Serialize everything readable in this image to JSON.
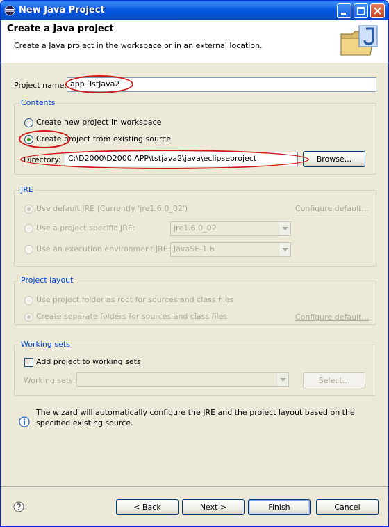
{
  "window": {
    "title": "New Java Project"
  },
  "banner": {
    "title": "Create a Java project",
    "description": "Create a Java project in the workspace or in an external location."
  },
  "project": {
    "label": "Project name:",
    "value": "app_TstJava2"
  },
  "contents": {
    "title": "Contents",
    "option_new": "Create new project in workspace",
    "option_existing": "Create project from existing source",
    "directory_label": "Directory:",
    "directory_value": "C:\\D2000\\D2000.APP\\tstjava2\\java\\eclipseproject",
    "browse_label": "Browse..."
  },
  "jre": {
    "title": "JRE",
    "option_default": "Use default JRE (Currently 'jre1.6.0_02')",
    "configure_label": "Configure default...",
    "option_specific": "Use a project specific JRE:",
    "specific_value": "jre1.6.0_02",
    "option_env": "Use an execution environment JRE:",
    "env_value": "JavaSE-1.6"
  },
  "layout": {
    "title": "Project layout",
    "option_root": "Use project folder as root for sources and class files",
    "option_separate": "Create separate folders for sources and class files",
    "configure_label": "Configure default..."
  },
  "working_sets": {
    "title": "Working sets",
    "add_label": "Add project to working sets",
    "sets_label": "Working sets:",
    "sets_value": "",
    "select_label": "Select..."
  },
  "info": {
    "message": "The wizard will automatically configure the JRE and the project layout based on the specified existing source."
  },
  "footer": {
    "back_label": "< Back",
    "next_label": "Next >",
    "finish_label": "Finish",
    "cancel_label": "Cancel"
  },
  "colors": {
    "titlebar": "#0858e4",
    "group_title": "#0046d5",
    "annotation": "#d01818"
  }
}
